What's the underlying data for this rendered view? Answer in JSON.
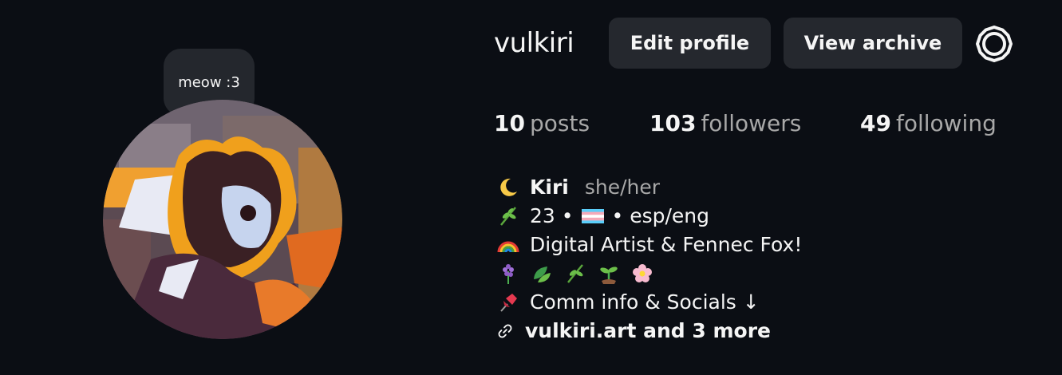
{
  "note": {
    "text": "meow :3"
  },
  "profile": {
    "username": "vulkiri",
    "edit_label": "Edit profile",
    "archive_label": "View archive",
    "settings_icon": "gear-icon"
  },
  "stats": {
    "posts_count": "10",
    "posts_label": "posts",
    "followers_count": "103",
    "followers_label": "followers",
    "following_count": "49",
    "following_label": "following"
  },
  "bio": {
    "name_icon": "moon-icon",
    "name": "Kiri",
    "pronouns": "she/her",
    "line2_icon": "herb-icon",
    "age": "23",
    "sep1": "•",
    "flag_icon": "trans-flag-icon",
    "sep2": "•",
    "languages": "esp/eng",
    "line3_icon": "rainbow-icon",
    "description": "Digital Artist & Fennec Fox!",
    "plant_icons": [
      "hyacinth-icon",
      "leaves-icon",
      "herb-icon",
      "seedling-icon",
      "blossom-icon"
    ],
    "line5_icon": "pushpin-icon",
    "comm_text": "Comm info & Socials ↓",
    "link_icon": "link-icon",
    "link_text": "vulkiri.art and 3 more"
  },
  "colors": {
    "background": "#0b0e14",
    "button_bg": "#25282e",
    "secondary_text": "#a8a8a8"
  }
}
